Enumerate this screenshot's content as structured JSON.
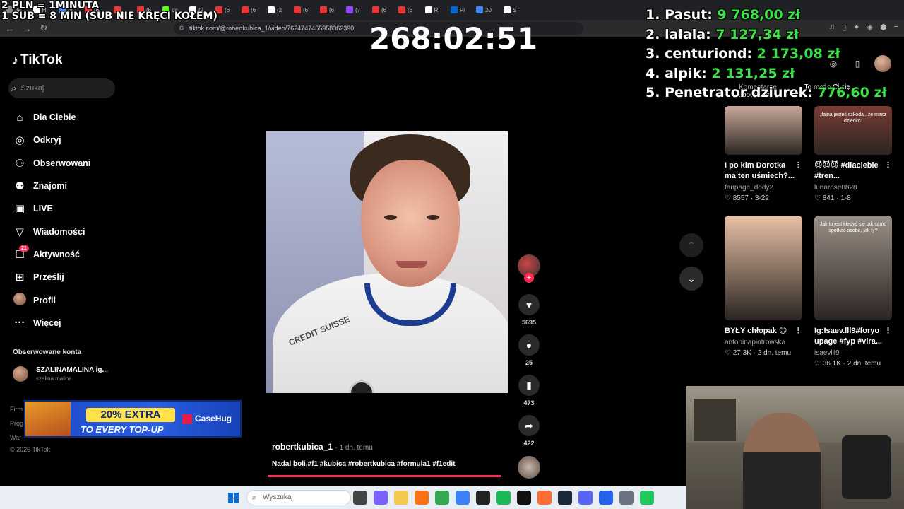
{
  "overlay": {
    "rate_line1": "2 PLN = 1MINUTA",
    "rate_line2": "1 SUB = 8 MIN (SUB NIE KRĘCI KOŁEM)",
    "timer": "268:02:51",
    "leaderboard": [
      {
        "rank": "1.",
        "name": "Pasut:",
        "amount": "9 768,00 zł"
      },
      {
        "rank": "2.",
        "name": "lalala:",
        "amount": "7 127,34 zł"
      },
      {
        "rank": "3.",
        "name": "centuriond:",
        "amount": "2 173,08 zł"
      },
      {
        "rank": "4.",
        "name": "alpik:",
        "amount": "2 131,25 zł"
      },
      {
        "rank": "5.",
        "name": "Penetrator dziurek:",
        "amount": "776,60 zł"
      }
    ]
  },
  "browser": {
    "url": "tiktok.com/@robertkubica_1/video/7624747465958362390",
    "tabs": [
      {
        "label": "Je",
        "color": "#888"
      },
      {
        "label": "H",
        "color": "#fff"
      },
      {
        "label": "pi",
        "color": "#4285f4"
      },
      {
        "label": "(6",
        "color": "#e33"
      },
      {
        "label": "",
        "color": "#e33"
      },
      {
        "label": "(6",
        "color": "#e33"
      },
      {
        "label": "dc",
        "color": "#53fc18"
      },
      {
        "label": "(2",
        "color": "#fff"
      },
      {
        "label": "(6",
        "color": "#e33"
      },
      {
        "label": "(6",
        "color": "#e33"
      },
      {
        "label": "(2",
        "color": "#fff"
      },
      {
        "label": "(6",
        "color": "#e33"
      },
      {
        "label": "(6",
        "color": "#e33"
      },
      {
        "label": "(7",
        "color": "#9146ff"
      },
      {
        "label": "(6",
        "color": "#e33"
      },
      {
        "label": "(6",
        "color": "#e33"
      },
      {
        "label": "R",
        "color": "#fff"
      },
      {
        "label": "Pi",
        "color": "#06c"
      },
      {
        "label": "20",
        "color": "#4285f4"
      },
      {
        "label": "S",
        "color": "#fff"
      }
    ]
  },
  "sidebar": {
    "logo": "TikTok",
    "search_placeholder": "Szukaj",
    "items": [
      {
        "label": "Dla Ciebie",
        "icon": "⌂"
      },
      {
        "label": "Odkryj",
        "icon": "◎"
      },
      {
        "label": "Obserwowani",
        "icon": "⚇"
      },
      {
        "label": "Znajomi",
        "icon": "⚉"
      },
      {
        "label": "LIVE",
        "icon": "▣"
      },
      {
        "label": "Wiadomości",
        "icon": "▽"
      },
      {
        "label": "Aktywność",
        "icon": "☐",
        "badge": "21"
      },
      {
        "label": "Prześlij",
        "icon": "⊞"
      },
      {
        "label": "Profil",
        "icon": "avatar"
      },
      {
        "label": "Więcej",
        "icon": "···"
      }
    ],
    "followed_title": "Obserwowane konta",
    "followed": {
      "name": "SZALINAMALINA ig...",
      "handle": "szalina.malina"
    },
    "footer": [
      "Firm",
      "Prog",
      "War"
    ],
    "copyright": "© 2026 TikTok"
  },
  "promo": {
    "headline": "20% EXTRA",
    "sub": "TO EVERY TOP-UP",
    "brand": "CaseHug"
  },
  "video": {
    "author": "robertkubica_1",
    "ago": "· 1 dn. temu",
    "caption": "Nadal boli.#f1 #kubica #robertkubica #formula1 #f1edit",
    "likes": "5695",
    "comments": "25",
    "saves": "473",
    "shares": "422",
    "suit_text": "CREDIT SUISSE",
    "progress": 0.98
  },
  "panel": {
    "tabs": [
      "Komentarze",
      "To może Ci się spodobać"
    ],
    "cards": [
      {
        "title": "I po kim Dorotka ma ten uśmiech?...",
        "user": "fanpage_dody2",
        "likes": "8557",
        "date": "3-22",
        "thumb": "#c8a89a",
        "overlay": ""
      },
      {
        "title": "😈😈😈 #dlaciebie #tren...",
        "user": "lunarose0828",
        "likes": "841",
        "date": "1-8",
        "thumb": "#7a3c34",
        "overlay": "„fajna jesteś szkoda , że masz dziecko”"
      },
      {
        "title": "BYŁY chłopak 😊",
        "user": "antoninapiotrowska",
        "likes": "27.3K",
        "date": "2 dn. temu",
        "thumb": "#e8c2a6",
        "overlay": ""
      },
      {
        "title": "Ig:Isaev.lll9#foryo upage #fyp #vira...",
        "user": "isaevlll9",
        "likes": "36.1K",
        "date": "2 dn. temu",
        "thumb": "#9a8f86",
        "overlay": "Jak to jest kiedyś się tak samo spotkać osoba, jak ty?"
      }
    ]
  },
  "taskbar": {
    "search_placeholder": "Wyszukaj",
    "apps": [
      "#444",
      "#7b61ff",
      "#f2c94c",
      "#f97316",
      "#34a853",
      "#3b82f6",
      "#222",
      "#1db954",
      "#111",
      "#ff6b35",
      "#1b2838",
      "#5865f2",
      "#2563eb",
      "#6b7280",
      "#22c55e"
    ]
  }
}
